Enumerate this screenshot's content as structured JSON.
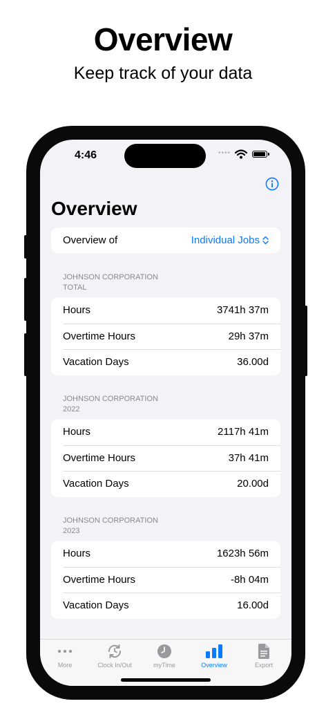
{
  "promo": {
    "title": "Overview",
    "subtitle": "Keep track of your data"
  },
  "status": {
    "time": "4:46"
  },
  "nav": {
    "title": "Overview"
  },
  "picker": {
    "label": "Overview of",
    "value": "Individual Jobs"
  },
  "sections": [
    {
      "header_line1": "JOHNSON CORPORATION",
      "header_line2": "TOTAL",
      "rows": [
        {
          "label": "Hours",
          "value": "3741h 37m"
        },
        {
          "label": "Overtime Hours",
          "value": "29h 37m"
        },
        {
          "label": "Vacation Days",
          "value": "36.00d"
        }
      ]
    },
    {
      "header_line1": "JOHNSON CORPORATION",
      "header_line2": "2022",
      "rows": [
        {
          "label": "Hours",
          "value": "2117h 41m"
        },
        {
          "label": "Overtime Hours",
          "value": "37h 41m"
        },
        {
          "label": "Vacation Days",
          "value": "20.00d"
        }
      ]
    },
    {
      "header_line1": "JOHNSON CORPORATION",
      "header_line2": "2023",
      "rows": [
        {
          "label": "Hours",
          "value": "1623h 56m"
        },
        {
          "label": "Overtime Hours",
          "value": "-8h 04m"
        },
        {
          "label": "Vacation Days",
          "value": "16.00d"
        }
      ]
    }
  ],
  "tabs": [
    {
      "label": "More",
      "icon": "ellipsis-icon"
    },
    {
      "label": "Clock In/Out",
      "icon": "clock-arrows-icon"
    },
    {
      "label": "myTime",
      "icon": "clock-icon"
    },
    {
      "label": "Overview",
      "icon": "chart-bars-icon",
      "active": true
    },
    {
      "label": "Export",
      "icon": "document-icon"
    }
  ],
  "colors": {
    "accent": "#0a7aff",
    "background": "#f2f2f7",
    "inactive_tab": "#9a9a9e"
  }
}
